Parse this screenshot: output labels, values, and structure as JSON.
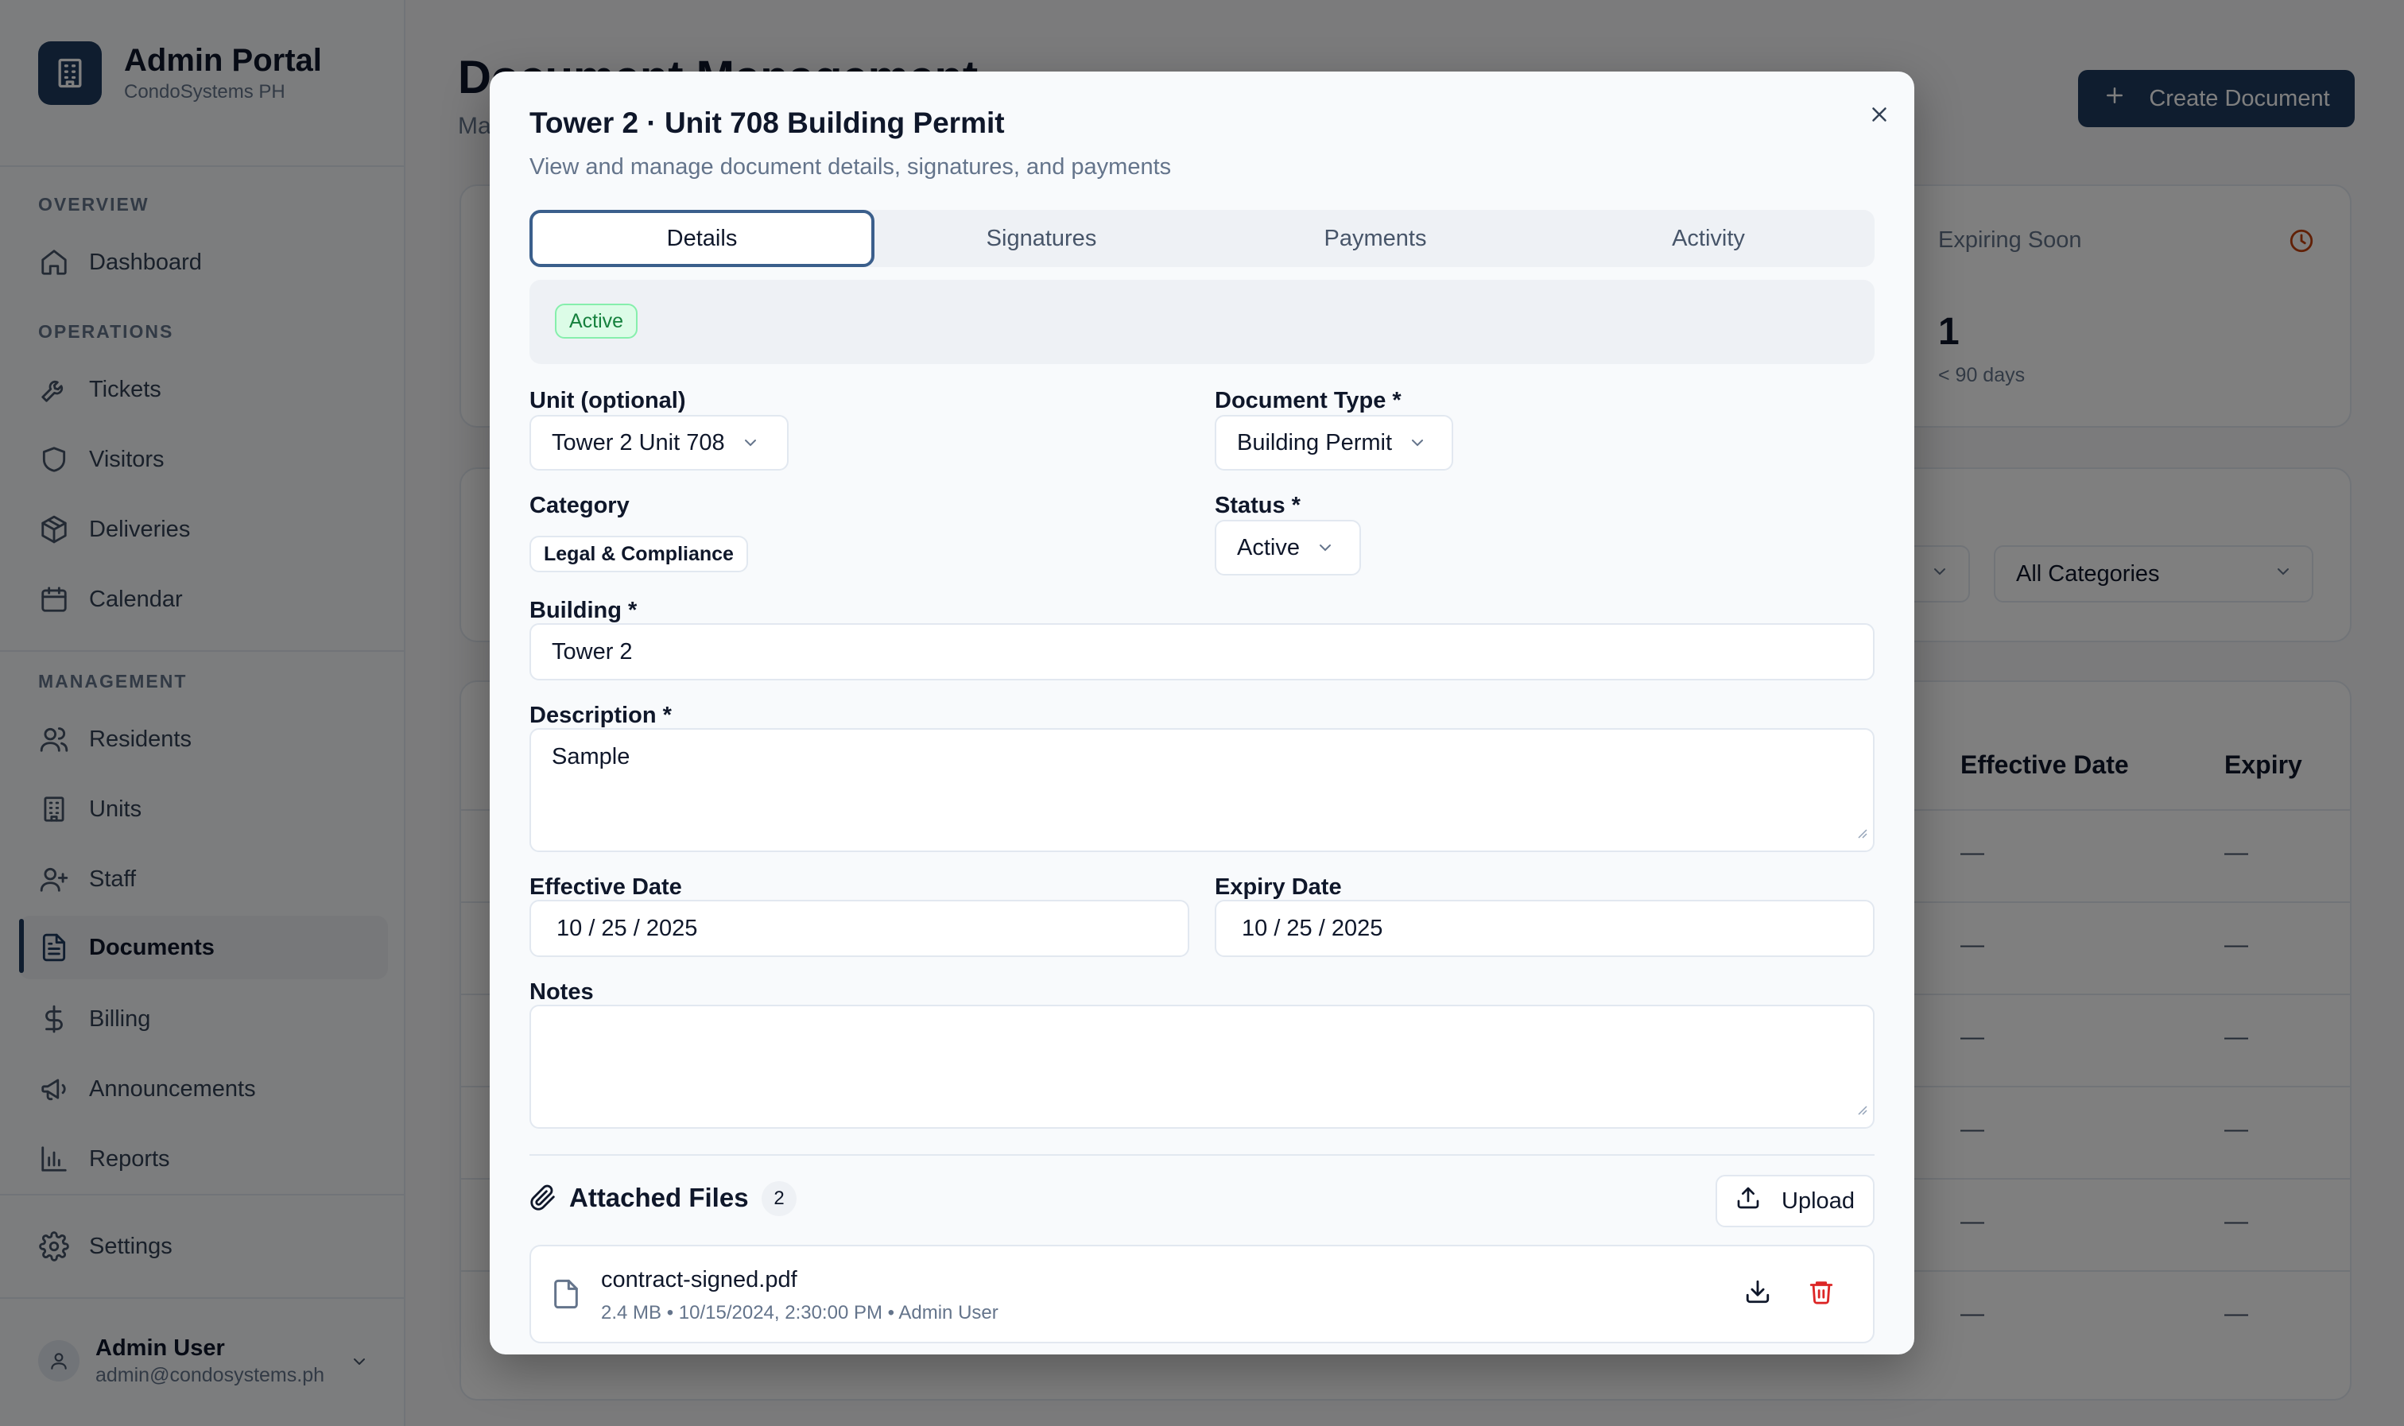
{
  "app": {
    "title": "Admin Portal",
    "subtitle": "CondoSystems PH"
  },
  "sidebar": {
    "sections": {
      "overview": "OVERVIEW",
      "operations": "OPERATIONS",
      "management": "MANAGEMENT"
    },
    "items": [
      {
        "label": "Dashboard",
        "icon": "home-icon"
      },
      {
        "label": "Tickets",
        "icon": "wrench-icon"
      },
      {
        "label": "Visitors",
        "icon": "shield-icon"
      },
      {
        "label": "Deliveries",
        "icon": "package-icon"
      },
      {
        "label": "Calendar",
        "icon": "calendar-icon"
      },
      {
        "label": "Residents",
        "icon": "users-icon"
      },
      {
        "label": "Units",
        "icon": "building-icon"
      },
      {
        "label": "Staff",
        "icon": "user-plus-icon"
      },
      {
        "label": "Documents",
        "icon": "document-icon",
        "active": true
      },
      {
        "label": "Billing",
        "icon": "dollar-icon"
      },
      {
        "label": "Announcements",
        "icon": "megaphone-icon"
      },
      {
        "label": "Reports",
        "icon": "bar-chart-icon"
      },
      {
        "label": "Settings",
        "icon": "gear-icon"
      }
    ],
    "user": {
      "name": "Admin User",
      "email": "admin@condosystems.ph"
    }
  },
  "main": {
    "title": "Document Management",
    "subtitle": "Ma",
    "create_button": "Create Document",
    "stat": {
      "label": "Expiring Soon",
      "value": "1",
      "note": "< 90 days"
    },
    "filter_category": "All Categories",
    "table": {
      "headers": [
        "Effective Date",
        "Expiry"
      ],
      "rows": [
        [
          "—",
          "—"
        ],
        [
          "—",
          "—"
        ],
        [
          "—",
          "—"
        ],
        [
          "—",
          "—"
        ],
        [
          "—",
          "—"
        ],
        [
          "—",
          "—"
        ]
      ]
    }
  },
  "modal": {
    "title": "Tower 2 · Unit 708 Building Permit",
    "description": "View and manage document details, signatures, and payments",
    "tabs": [
      "Details",
      "Signatures",
      "Payments",
      "Activity"
    ],
    "active_tab": "Details",
    "status_badge": "Active",
    "fields": {
      "unit": {
        "label": "Unit (optional)",
        "value": "Tower 2 Unit 708"
      },
      "document_type": {
        "label": "Document Type *",
        "value": "Building Permit"
      },
      "category": {
        "label": "Category",
        "value": "Legal & Compliance"
      },
      "status": {
        "label": "Status *",
        "value": "Active"
      },
      "building": {
        "label": "Building *",
        "value": "Tower 2"
      },
      "description": {
        "label": "Description *",
        "value": "Sample"
      },
      "effective_date": {
        "label": "Effective Date",
        "value": "10 / 25 / 2025"
      },
      "expiry_date": {
        "label": "Expiry Date",
        "value": "10 / 25 / 2025"
      },
      "notes": {
        "label": "Notes",
        "value": ""
      }
    },
    "attachments": {
      "title": "Attached Files",
      "count": "2",
      "upload_label": "Upload",
      "files": [
        {
          "name": "contract-signed.pdf",
          "meta": "2.4 MB • 10/15/2024, 2:30:00 PM • Admin User"
        }
      ]
    }
  },
  "colors": {
    "brand": "#1e3a5f",
    "active_badge": "#15803d",
    "danger": "#dc2626",
    "warning": "#c2410c"
  }
}
